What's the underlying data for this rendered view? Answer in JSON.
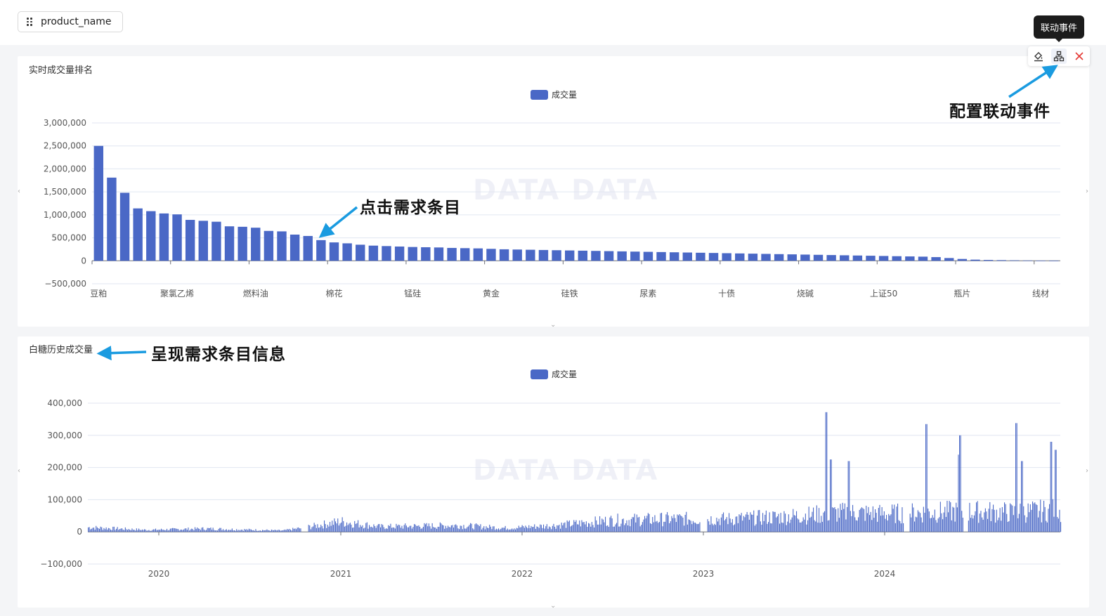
{
  "filter": {
    "label": "product_name"
  },
  "tooltip": {
    "label": "联动事件"
  },
  "toolbar": {
    "icons": [
      "paint-bucket-icon",
      "linkage-tree-icon",
      "close-icon"
    ]
  },
  "annotations": {
    "config": "配置联动事件",
    "click": "点击需求条目",
    "show": "呈现需求条目信息"
  },
  "watermark": "DATA DATA",
  "colors": {
    "bar": "#4a68c6",
    "close": "#e53935",
    "arrow": "#1a9be0"
  },
  "chart_data": [
    {
      "type": "bar",
      "title": "实时成交量排名",
      "legend": [
        "成交量"
      ],
      "legend_position": "top-center",
      "ylim": [
        -500000,
        3000000
      ],
      "yticks": [
        -500000,
        0,
        500000,
        1000000,
        1500000,
        2000000,
        2500000,
        3000000
      ],
      "ytick_labels": [
        "−500,000",
        "0",
        "500,000",
        "1,000,000",
        "1,500,000",
        "2,000,000",
        "2,500,000",
        "3,000,000"
      ],
      "grid": true,
      "xtick_labels": [
        {
          "index": 0,
          "label": "豆粕"
        },
        {
          "index": 6,
          "label": "聚氯乙烯"
        },
        {
          "index": 12,
          "label": "燃料油"
        },
        {
          "index": 18,
          "label": "棉花"
        },
        {
          "index": 24,
          "label": "锰硅"
        },
        {
          "index": 30,
          "label": "黄金"
        },
        {
          "index": 36,
          "label": "硅铁"
        },
        {
          "index": 42,
          "label": "尿素"
        },
        {
          "index": 48,
          "label": "十债"
        },
        {
          "index": 54,
          "label": "烧碱"
        },
        {
          "index": 60,
          "label": "上证50"
        },
        {
          "index": 66,
          "label": "瓶片"
        },
        {
          "index": 72,
          "label": "线材"
        }
      ],
      "values": [
        2500000,
        1810000,
        1480000,
        1140000,
        1080000,
        1030000,
        1010000,
        890000,
        870000,
        850000,
        750000,
        740000,
        720000,
        650000,
        640000,
        570000,
        540000,
        450000,
        400000,
        380000,
        350000,
        330000,
        320000,
        310000,
        300000,
        295000,
        290000,
        280000,
        275000,
        270000,
        260000,
        250000,
        245000,
        240000,
        235000,
        230000,
        225000,
        220000,
        215000,
        210000,
        205000,
        200000,
        195000,
        190000,
        185000,
        180000,
        175000,
        170000,
        165000,
        160000,
        155000,
        150000,
        145000,
        140000,
        135000,
        130000,
        125000,
        120000,
        115000,
        110000,
        105000,
        100000,
        95000,
        90000,
        80000,
        60000,
        40000,
        25000,
        18000,
        14000,
        10000,
        7000,
        4000,
        2000
      ]
    },
    {
      "type": "bar",
      "title": "白糖历史成交量",
      "legend": [
        "成交量"
      ],
      "legend_position": "top-center",
      "ylim": [
        -100000,
        400000
      ],
      "yticks": [
        -100000,
        0,
        100000,
        200000,
        300000,
        400000
      ],
      "ytick_labels": [
        "−100,000",
        "0",
        "100,000",
        "200,000",
        "300,000",
        "400,000"
      ],
      "grid": true,
      "xtick_labels": [
        "2020",
        "2021",
        "2022",
        "2023",
        "2024"
      ],
      "x_range": [
        "2019-09",
        "2024-12"
      ],
      "peaks": [
        {
          "date": "2023-09",
          "value": 372000
        },
        {
          "date": "2024-04",
          "value": 335000
        },
        {
          "date": "2024-09",
          "value": 338000
        },
        {
          "date": "2024-12",
          "value": 280000
        }
      ]
    }
  ]
}
